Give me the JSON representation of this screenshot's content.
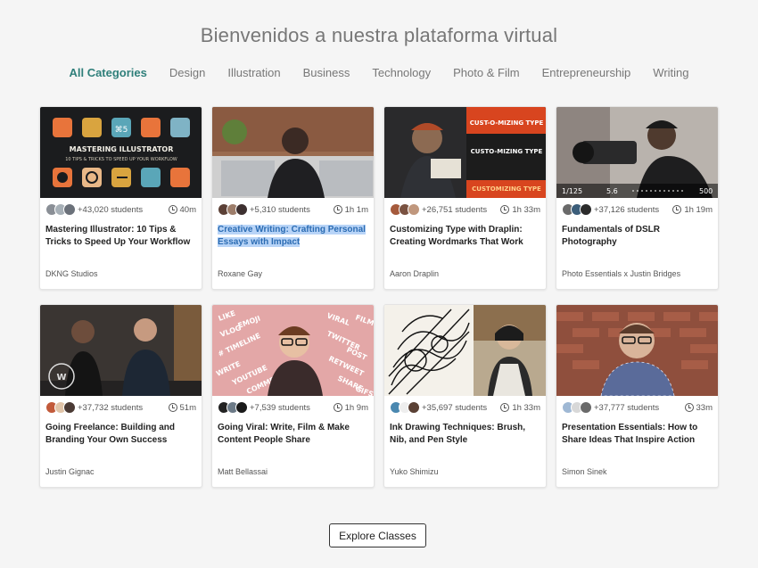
{
  "page": {
    "title": "Bienvenidos a nuestra plataforma virtual"
  },
  "tabs": [
    {
      "label": "All Categories",
      "active": true
    },
    {
      "label": "Design",
      "active": false
    },
    {
      "label": "Illustration",
      "active": false
    },
    {
      "label": "Business",
      "active": false
    },
    {
      "label": "Technology",
      "active": false
    },
    {
      "label": "Photo & Film",
      "active": false
    },
    {
      "label": "Entrepreneurship",
      "active": false
    },
    {
      "label": "Writing",
      "active": false
    }
  ],
  "courses": [
    {
      "students": "+43,020 students",
      "duration": "40m",
      "title": "Mastering Illustrator: 10 Tips & Tricks to Speed Up Your Workflow",
      "author": "DKNG Studios",
      "thumb_text": {
        "line1": "MASTERING ILLUSTRATOR",
        "line2": "10 TIPS & TRICKS TO SPEED UP YOUR WORKFLOW",
        "cmd": "⌘5"
      }
    },
    {
      "students": "+5,310 students",
      "duration": "1h 1m",
      "title": "Creative Writing: Crafting Personal Essays with Impact",
      "author": "Roxane Gay",
      "highlighted": true
    },
    {
      "students": "+26,751 students",
      "duration": "1h 33m",
      "title": "Customizing Type with Draplin: Creating Wordmarks That Work",
      "author": "Aaron Draplin",
      "thumb_text": {
        "line1": "CUST-O-MIZING TYPE",
        "line2": "CUSTO-MIZING TYPE",
        "line3": "CUSTOMIZING TYPE"
      }
    },
    {
      "students": "+37,126 students",
      "duration": "1h 19m",
      "title": "Fundamentals of DSLR Photography",
      "author": "Photo Essentials x Justin Bridges",
      "thumb_text": {
        "shutter": "1/125",
        "aperture": "5.6",
        "iso": "500"
      }
    },
    {
      "students": "+37,732 students",
      "duration": "51m",
      "title": "Going Freelance: Building and Branding Your Own Success",
      "author": "Justin Gignac",
      "thumb_text": {
        "logo": "W"
      }
    },
    {
      "students": "+7,539 students",
      "duration": "1h 9m",
      "title": "Going Viral: Write, Film & Make Content People Share",
      "author": "Matt Bellassai",
      "thumb_text": {
        "words": [
          "LIKE",
          "VLOG",
          "EMOJI",
          "# TIMELINE",
          "WRITE",
          "YOUTUBE",
          "COMMENT",
          "VIRAL",
          "TWITTER",
          "POST",
          "RETWEET",
          "SHARE",
          "FILM",
          "GIFS"
        ]
      }
    },
    {
      "students": "+35,697 students",
      "duration": "1h 33m",
      "title": "Ink Drawing Techniques: Brush, Nib, and Pen Style",
      "author": "Yuko Shimizu"
    },
    {
      "students": "+37,777 students",
      "duration": "33m",
      "title": "Presentation Essentials: How to Share Ideas That Inspire Action",
      "author": "Simon Sinek"
    }
  ],
  "footer": {
    "explore_label": "Explore Classes"
  },
  "colors": {
    "accent": "#2f7f7a",
    "highlight_bg": "#b8d4f7",
    "highlight_text": "#2b6cb3"
  }
}
